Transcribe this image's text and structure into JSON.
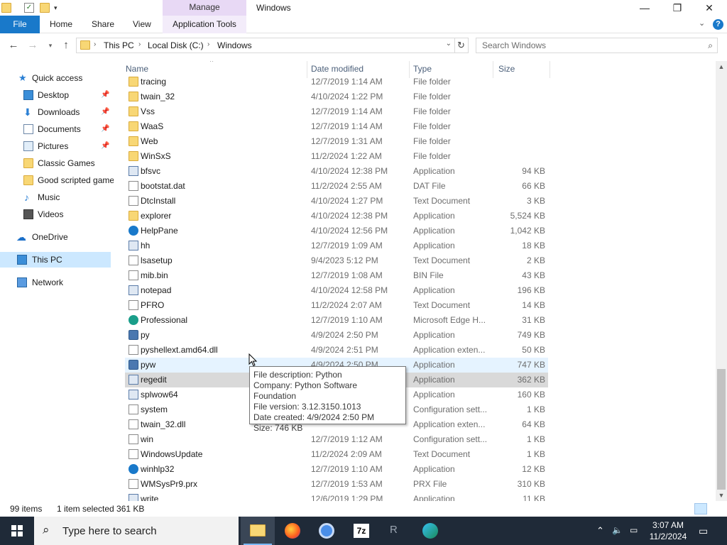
{
  "title_bar": {
    "contextual_tab": "Manage",
    "window_title": "Windows",
    "controls": {
      "minimize": "—",
      "maximize": "❐",
      "close": "✕"
    }
  },
  "ribbon": {
    "file": "File",
    "tabs": [
      "Home",
      "Share",
      "View"
    ],
    "contextual_sub_tab": "Application Tools",
    "help": "?"
  },
  "address_bar": {
    "crumbs": [
      "This PC",
      "Local Disk (C:)",
      "Windows"
    ],
    "search_placeholder": "Search Windows"
  },
  "nav_pane": {
    "quick_access": "Quick access",
    "items": [
      {
        "label": "Desktop",
        "pinned": true
      },
      {
        "label": "Downloads",
        "pinned": true
      },
      {
        "label": "Documents",
        "pinned": true
      },
      {
        "label": "Pictures",
        "pinned": true
      },
      {
        "label": "Classic Games",
        "pinned": false
      },
      {
        "label": "Good scripted games",
        "pinned": false
      },
      {
        "label": "Music",
        "pinned": false
      },
      {
        "label": "Videos",
        "pinned": false
      }
    ],
    "onedrive": "OneDrive",
    "this_pc": "This PC",
    "network": "Network"
  },
  "columns": {
    "name": "Name",
    "date": "Date modified",
    "type": "Type",
    "size": "Size"
  },
  "files": [
    {
      "name": "tracing",
      "date": "12/7/2019 1:14 AM",
      "type": "File folder",
      "size": "",
      "icon": "folder"
    },
    {
      "name": "twain_32",
      "date": "4/10/2024 1:22 PM",
      "type": "File folder",
      "size": "",
      "icon": "folder"
    },
    {
      "name": "Vss",
      "date": "12/7/2019 1:14 AM",
      "type": "File folder",
      "size": "",
      "icon": "folder"
    },
    {
      "name": "WaaS",
      "date": "12/7/2019 1:14 AM",
      "type": "File folder",
      "size": "",
      "icon": "folder"
    },
    {
      "name": "Web",
      "date": "12/7/2019 1:31 AM",
      "type": "File folder",
      "size": "",
      "icon": "folder"
    },
    {
      "name": "WinSxS",
      "date": "11/2/2024 1:22 AM",
      "type": "File folder",
      "size": "",
      "icon": "folder"
    },
    {
      "name": "bfsvc",
      "date": "4/10/2024 12:38 PM",
      "type": "Application",
      "size": "94 KB",
      "icon": "app"
    },
    {
      "name": "bootstat.dat",
      "date": "11/2/2024 2:55 AM",
      "type": "DAT File",
      "size": "66 KB",
      "icon": "doc"
    },
    {
      "name": "DtcInstall",
      "date": "4/10/2024 1:27 PM",
      "type": "Text Document",
      "size": "3 KB",
      "icon": "doc"
    },
    {
      "name": "explorer",
      "date": "4/10/2024 12:38 PM",
      "type": "Application",
      "size": "5,524 KB",
      "icon": "folder"
    },
    {
      "name": "HelpPane",
      "date": "4/10/2024 12:56 PM",
      "type": "Application",
      "size": "1,042 KB",
      "icon": "help"
    },
    {
      "name": "hh",
      "date": "12/7/2019 1:09 AM",
      "type": "Application",
      "size": "18 KB",
      "icon": "app"
    },
    {
      "name": "lsasetup",
      "date": "9/4/2023 5:12 PM",
      "type": "Text Document",
      "size": "2 KB",
      "icon": "doc"
    },
    {
      "name": "mib.bin",
      "date": "12/7/2019 1:08 AM",
      "type": "BIN File",
      "size": "43 KB",
      "icon": "doc"
    },
    {
      "name": "notepad",
      "date": "4/10/2024 12:58 PM",
      "type": "Application",
      "size": "196 KB",
      "icon": "app"
    },
    {
      "name": "PFRO",
      "date": "11/2/2024 2:07 AM",
      "type": "Text Document",
      "size": "14 KB",
      "icon": "doc"
    },
    {
      "name": "Professional",
      "date": "12/7/2019 1:10 AM",
      "type": "Microsoft Edge H...",
      "size": "31 KB",
      "icon": "edge"
    },
    {
      "name": "py",
      "date": "4/9/2024 2:50 PM",
      "type": "Application",
      "size": "749 KB",
      "icon": "py"
    },
    {
      "name": "pyshellext.amd64.dll",
      "date": "4/9/2024 2:51 PM",
      "type": "Application exten...",
      "size": "50 KB",
      "icon": "doc"
    },
    {
      "name": "pyw",
      "date": "4/9/2024 2:50 PM",
      "type": "Application",
      "size": "747 KB",
      "icon": "py"
    },
    {
      "name": "regedit",
      "date": "",
      "type": "Application",
      "size": "362 KB",
      "icon": "app"
    },
    {
      "name": "splwow64",
      "date": "",
      "type": "Application",
      "size": "160 KB",
      "icon": "app"
    },
    {
      "name": "system",
      "date": "",
      "type": "Configuration sett...",
      "size": "1 KB",
      "icon": "doc"
    },
    {
      "name": "twain_32.dll",
      "date": "",
      "type": "Application exten...",
      "size": "64 KB",
      "icon": "doc"
    },
    {
      "name": "win",
      "date": "12/7/2019 1:12 AM",
      "type": "Configuration sett...",
      "size": "1 KB",
      "icon": "doc"
    },
    {
      "name": "WindowsUpdate",
      "date": "11/2/2024 2:09 AM",
      "type": "Text Document",
      "size": "1 KB",
      "icon": "doc"
    },
    {
      "name": "winhlp32",
      "date": "12/7/2019 1:10 AM",
      "type": "Application",
      "size": "12 KB",
      "icon": "help"
    },
    {
      "name": "WMSysPr9.prx",
      "date": "12/7/2019 1:53 AM",
      "type": "PRX File",
      "size": "310 KB",
      "icon": "doc"
    },
    {
      "name": "write",
      "date": "12/6/2019 1:29 PM",
      "type": "Application",
      "size": "11 KB",
      "icon": "app"
    }
  ],
  "hover_index": 19,
  "selected_index": 20,
  "tooltip": {
    "lines": [
      "File description: Python",
      "Company: Python Software Foundation",
      "File version: 3.12.3150.1013",
      "Date created: 4/9/2024 2:50 PM",
      "Size: 746 KB"
    ]
  },
  "status": {
    "count": "99 items",
    "selection": "1 item selected  361 KB"
  },
  "taskbar": {
    "search_placeholder": "Type here to search",
    "apps": [
      "file-explorer-icon",
      "firefox-icon",
      "chrome-icon",
      "7zip-icon",
      "r-icon",
      "edge-icon"
    ],
    "time": "3:07 AM",
    "date": "11/2/2024"
  }
}
